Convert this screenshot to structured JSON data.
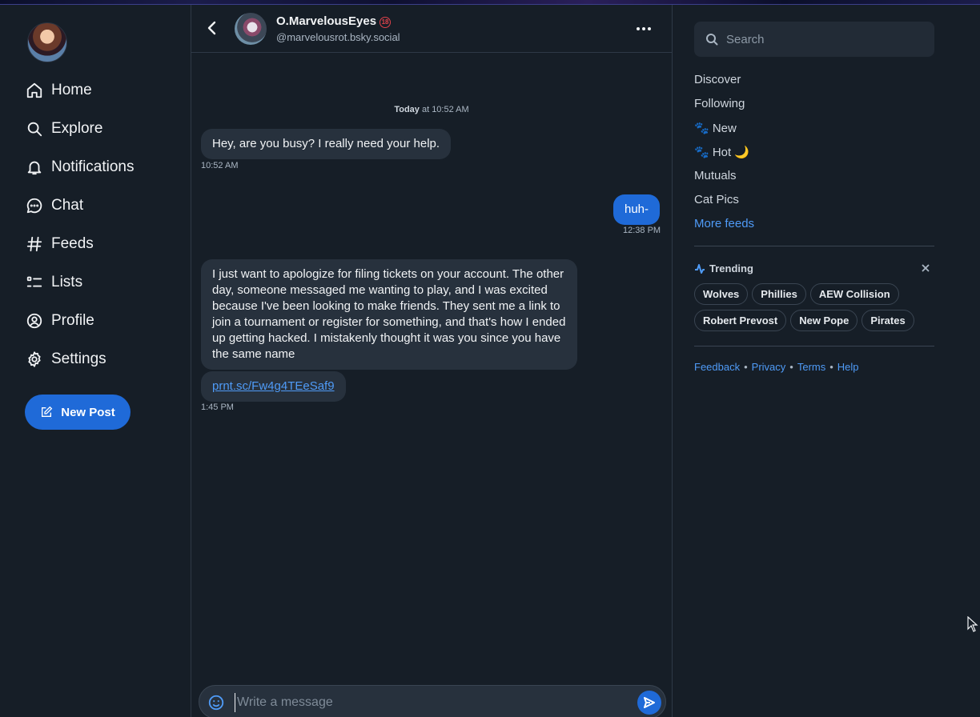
{
  "nav": {
    "items": [
      {
        "label": "Home",
        "icon": "home-icon"
      },
      {
        "label": "Explore",
        "icon": "search-icon"
      },
      {
        "label": "Notifications",
        "icon": "bell-icon"
      },
      {
        "label": "Chat",
        "icon": "chat-icon"
      },
      {
        "label": "Feeds",
        "icon": "hash-icon"
      },
      {
        "label": "Lists",
        "icon": "list-icon"
      },
      {
        "label": "Profile",
        "icon": "user-circle-icon"
      },
      {
        "label": "Settings",
        "icon": "gear-icon"
      }
    ],
    "new_post_label": "New Post"
  },
  "chat": {
    "peer_name": "O.MarvelousEyes",
    "peer_badge": "18",
    "peer_handle": "@marvelousrot.bsky.social",
    "day_label_bold": "Today",
    "day_label_rest": " at 10:52 AM",
    "messages": [
      {
        "from": "peer",
        "text": "Hey, are you busy? I really need your help.",
        "time": "10:52 AM"
      },
      {
        "from": "me",
        "text": "huh-",
        "time": "12:38 PM"
      },
      {
        "from": "peer",
        "text": "I just want to apologize for filing tickets on your account. The other day, someone messaged me wanting to play, and I was excited because I've been looking to make friends. They sent me a link to join a tournament or register for something, and that's how I ended up getting hacked. I mistakenly thought it was you since you have the same name"
      },
      {
        "from": "peer",
        "link": "prnt.sc/Fw4g4TEeSaf9",
        "time": "1:45 PM"
      }
    ],
    "composer_placeholder": "Write a message"
  },
  "right": {
    "search_placeholder": "Search",
    "feeds": [
      "Discover",
      "Following",
      "🐾 New",
      "🐾 Hot 🌙",
      "Mutuals",
      "Cat Pics"
    ],
    "more_feeds_label": "More feeds",
    "trending_title": "Trending",
    "trending": [
      "Wolves",
      "Phillies",
      "AEW Collision",
      "Robert Prevost",
      "New Pope",
      "Pirates"
    ],
    "footer": [
      "Feedback",
      "Privacy",
      "Terms",
      "Help"
    ]
  },
  "colors": {
    "background": "#161e27",
    "accent": "#1f6ad8",
    "link": "#4f9bf7",
    "bubble_in": "#27313d"
  }
}
